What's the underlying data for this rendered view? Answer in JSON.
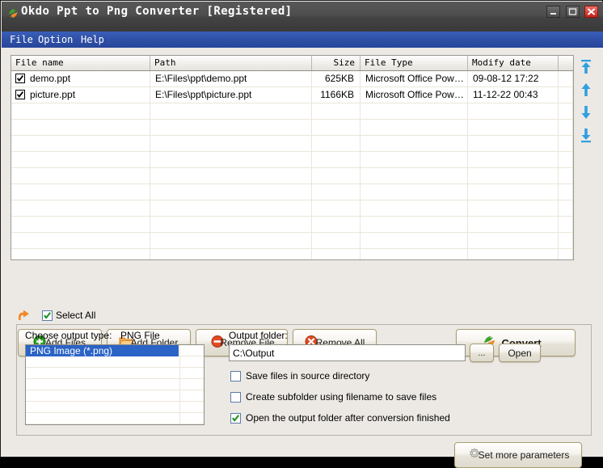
{
  "window": {
    "title": "Okdo Ppt to Png Converter [Registered]",
    "app_icon": "converter-swoosh-icon",
    "minimize_label": "Minimize",
    "maximize_label": "Maximize",
    "close_label": "Close"
  },
  "menubar": {
    "items": [
      {
        "label": "File"
      },
      {
        "label": "Option"
      },
      {
        "label": "Help"
      }
    ]
  },
  "file_list": {
    "columns": [
      {
        "label": "File name",
        "align": "left"
      },
      {
        "label": "Path",
        "align": "left"
      },
      {
        "label": "Size",
        "align": "right"
      },
      {
        "label": "File Type",
        "align": "left"
      },
      {
        "label": "Modify date",
        "align": "left"
      },
      {
        "label": "",
        "align": "left"
      }
    ],
    "rows": [
      {
        "checked": true,
        "name": "demo.ppt",
        "path": "E:\\Files\\ppt\\demo.ppt",
        "size": "625KB",
        "type": "Microsoft Office PowerP...",
        "modified": "09-08-12 17:22",
        "extra": ""
      },
      {
        "checked": true,
        "name": "picture.ppt",
        "path": "E:\\Files\\ppt\\picture.ppt",
        "size": "1166KB",
        "type": "Microsoft Office PowerP...",
        "modified": "11-12-22 00:43",
        "extra": ""
      }
    ],
    "empty_rows": 11
  },
  "order_buttons": [
    {
      "name": "move-to-top",
      "label": "Move to top"
    },
    {
      "name": "move-up",
      "label": "Move up"
    },
    {
      "name": "move-down",
      "label": "Move down"
    },
    {
      "name": "move-to-bottom",
      "label": "Move to bottom"
    }
  ],
  "select_all": {
    "icon": "orange-up-arrow-icon",
    "label": "Select All",
    "checked": true
  },
  "toolbar": {
    "add_files_label": "Add Files",
    "add_folder_label": "Add Folder",
    "remove_file_label": "Remove File",
    "remove_all_label": "Remove All",
    "convert_label": "Convert"
  },
  "output": {
    "choose_type_label": "Choose output type:",
    "choose_type_value": "PNG File",
    "type_options": [
      "PNG Image (*.png)"
    ],
    "type_selected": "PNG Image (*.png)",
    "folder_label": "Output folder:",
    "folder_value": "C:\\Output",
    "folder_placeholder": "C:\\Output",
    "browse_label": "...",
    "open_label": "Open",
    "set_params_label": "Set more parameters",
    "checkboxes": [
      {
        "label": "Save files in source directory",
        "checked": false
      },
      {
        "label": "Create subfolder using filename to save files",
        "checked": false
      },
      {
        "label": "Open the output folder after conversion finished",
        "checked": true
      }
    ]
  },
  "colors": {
    "menubar": "#2f50a6",
    "titlebar": "#4a4a4a",
    "selection": "#2b63c6",
    "close_button": "#c0241c",
    "accent_orange": "#f08a27",
    "accent_green": "#3da32e"
  }
}
